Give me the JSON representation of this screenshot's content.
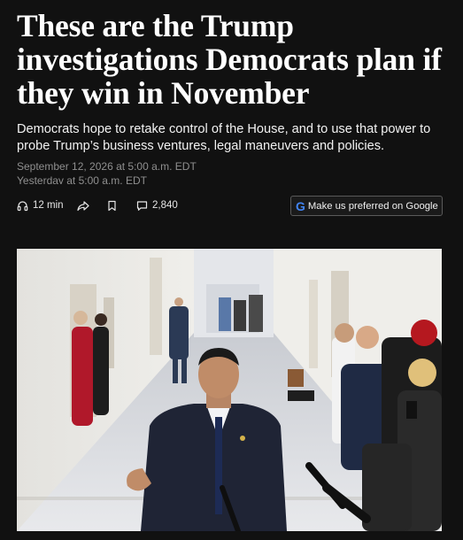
{
  "article": {
    "headline": "These are the Trump investigations Democrats plan if they win in November",
    "dek": "Democrats hope to retake control of the House, and to use that power to probe Trump’s business ventures, legal maneuvers and policies.",
    "published": "September 12, 2026 at 5:00 a.m. EDT",
    "updated": "Yesterday at 5:00 a.m. EDT"
  },
  "toolbar": {
    "read_time": "12 min",
    "share_icon": "share-icon",
    "bookmark_icon": "bookmark-icon",
    "comments_icon": "comment-icon",
    "comment_count": "2,840",
    "headphones_icon": "headphones-icon",
    "google_logo": "G",
    "google_button": "Make us preferred on Google"
  },
  "colors": {
    "page_background": "#111111",
    "text_primary": "#ffffff",
    "text_muted": "#8f8f8f",
    "button_border": "#5a5a5a"
  }
}
